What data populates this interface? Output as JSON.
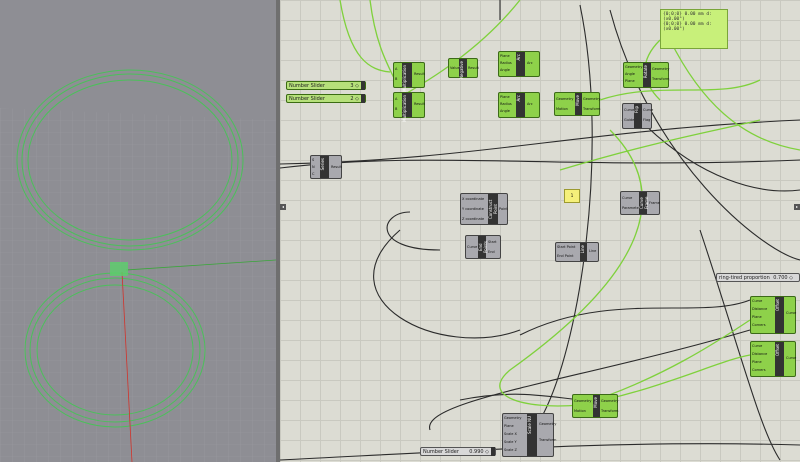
{
  "colors": {
    "canvas_bg": "#dcdcd3",
    "viewport_bg": "#8e8e94",
    "wire_selected": "#7fd13c",
    "wire_default": "#2b2b2b",
    "node_selected": "#8ed14a",
    "node_default": "#a9a9ae",
    "axis_red": "#d0342c",
    "axis_green": "#3aa63a"
  },
  "sliders": [
    {
      "label": "Number Slider",
      "value": "3 ◇",
      "selected": true
    },
    {
      "label": "Number Slider",
      "value": "2 ◇",
      "selected": true
    },
    {
      "label": "ring-tired proportion",
      "value": "0.700 ◇",
      "selected": false
    },
    {
      "label": "Number Slider",
      "value": "0.990 ◇",
      "selected": false
    }
  ],
  "readout": {
    "line1": "{0;0;0} 0.00 mm  d:(x0.00°)",
    "line2": "{0;0;0} 0.00 mm  d:(x0.00°)"
  },
  "note_value": "1",
  "nodes": {
    "series": {
      "title": "Series",
      "pins_in": [
        "S",
        "N",
        "C"
      ],
      "pins_out": [
        "Result"
      ]
    },
    "offset1": {
      "title": "Offset",
      "pins_in": [
        "Curve",
        "Distance",
        "Plane",
        "Corners"
      ],
      "pins_out": [
        "Curve"
      ]
    },
    "offset2": {
      "title": "Offset",
      "pins_in": [
        "Curve",
        "Distance",
        "Plane",
        "Corners"
      ],
      "pins_out": [
        "Curve"
      ]
    },
    "scale_nu": {
      "title": "Scale NU",
      "pins_in": [
        "Geometry",
        "Plane",
        "Scale X",
        "Scale Y",
        "Scale Z"
      ],
      "pins_out": [
        "Geometry",
        "Transform"
      ]
    },
    "construct_point": {
      "title": "Construct Point",
      "pins_in": [
        "X coordinate",
        "Y coordinate",
        "Z coordinate"
      ],
      "pins_out": [
        "Point"
      ]
    },
    "line": {
      "title": "Line",
      "pins_in": [
        "Start Point",
        "End Point"
      ],
      "pins_out": [
        "Line"
      ]
    },
    "end_points": {
      "title": "End Points",
      "pins_in": [
        "Curve"
      ],
      "pins_out": [
        "Start",
        "End"
      ]
    },
    "move1": {
      "title": "Move",
      "pins_in": [
        "Geometry",
        "Motion"
      ],
      "pins_out": [
        "Geometry",
        "Transform"
      ]
    },
    "move2": {
      "title": "Move",
      "pins_in": [
        "Geometry",
        "Motion"
      ],
      "pins_out": [
        "Geometry",
        "Transform"
      ]
    },
    "arc1": {
      "title": "Arc",
      "pins_in": [
        "Plane",
        "Radius",
        "Angle"
      ],
      "pins_out": [
        "Arc"
      ]
    },
    "arc2": {
      "title": "Arc",
      "pins_in": [
        "Plane",
        "Radius",
        "Angle"
      ],
      "pins_out": [
        "Arc"
      ]
    },
    "multiply1": {
      "title": "Multiplication",
      "pins_in": [
        "A",
        "B"
      ],
      "pins_out": [
        "Result"
      ]
    },
    "multiply2": {
      "title": "Multiplication",
      "pins_in": [
        "A",
        "B"
      ],
      "pins_out": [
        "Result"
      ]
    },
    "negative": {
      "title": "Negative",
      "pins_in": [
        "Value"
      ],
      "pins_out": [
        "Result"
      ]
    },
    "curve_frame": {
      "title": "Curve Frame",
      "pins_in": [
        "Curve",
        "Parameter"
      ],
      "pins_out": [
        "Frame"
      ]
    },
    "rotate": {
      "title": "Rotate",
      "pins_in": [
        "Geometry",
        "Angle",
        "Plane"
      ],
      "pins_out": [
        "Geometry",
        "Transform"
      ]
    },
    "flip": {
      "title": "Flip",
      "pins_in": [
        "Curve",
        "Guide"
      ],
      "pins_out": [
        "Curve",
        "Flag"
      ]
    }
  }
}
